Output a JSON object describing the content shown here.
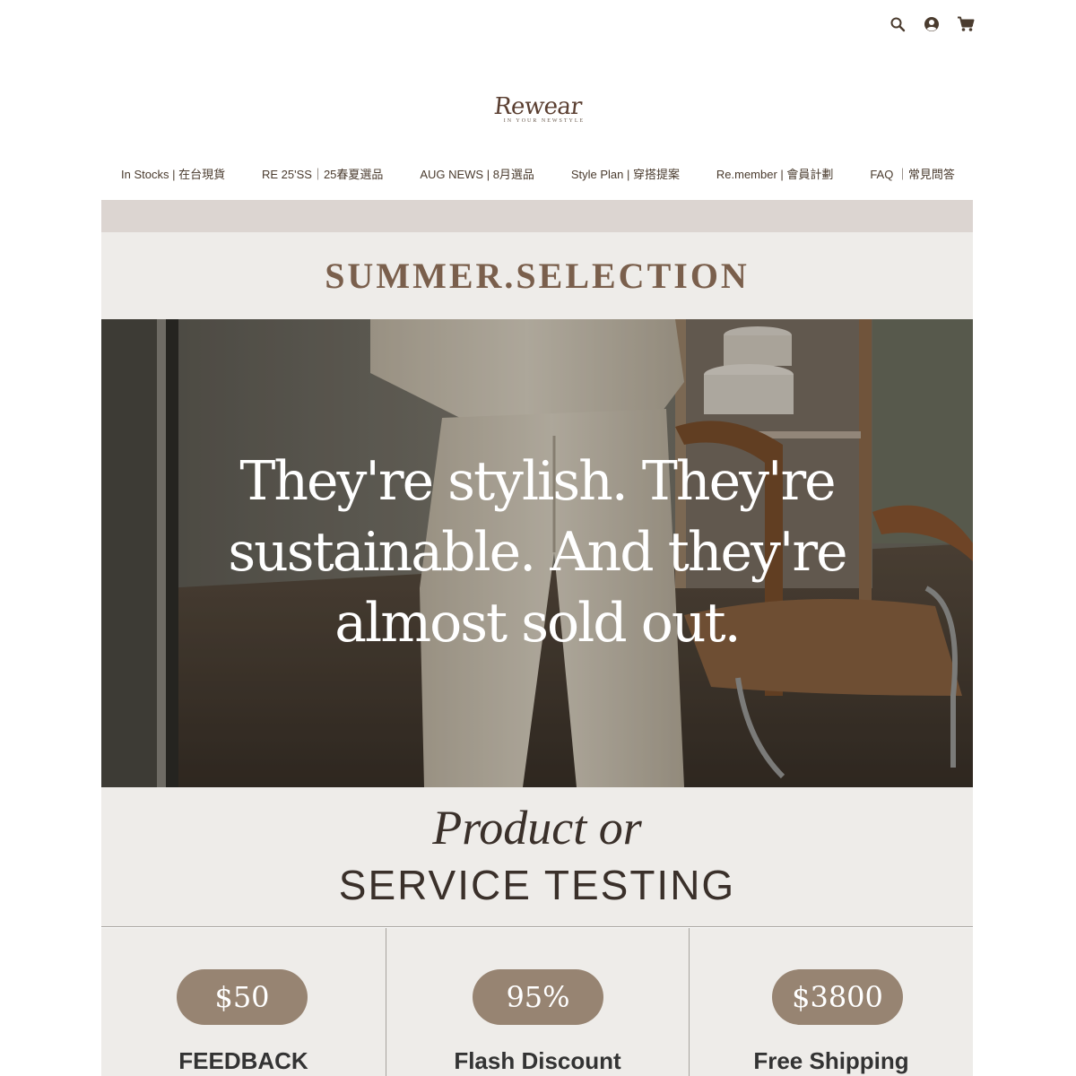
{
  "brand": {
    "name": "Rewear",
    "tagline": "IN YOUR NEWSTYLE"
  },
  "header_icons": [
    "search-icon",
    "account-icon",
    "cart-icon"
  ],
  "nav": {
    "items": [
      {
        "label": "In Stocks | 在台現貨"
      },
      {
        "label": "RE 25'SS｜25春夏選品"
      },
      {
        "label": "AUG NEWS | 8月選品"
      },
      {
        "label": "Style Plan | 穿搭提案"
      },
      {
        "label": "Re.member | 會員計劃"
      },
      {
        "label": "FAQ ｜常見問答"
      }
    ]
  },
  "section": {
    "title": "SUMMER.SELECTION"
  },
  "hero": {
    "headline_lines": [
      "They're stylish. They're",
      "sustainable. And they're",
      "almost sold out."
    ]
  },
  "testing": {
    "line1": "Product or",
    "line2": "SERVICE TESTING"
  },
  "cards": [
    {
      "value": "$50",
      "label": "FEEDBACK"
    },
    {
      "value": "95%",
      "label": "Flash Discount"
    },
    {
      "value": "$3800",
      "label": "Free Shipping"
    }
  ],
  "colors": {
    "accent_brown": "#7a5f4c",
    "pill": "#978472",
    "band": "#dcd5d1",
    "panel": "#eeece9"
  }
}
